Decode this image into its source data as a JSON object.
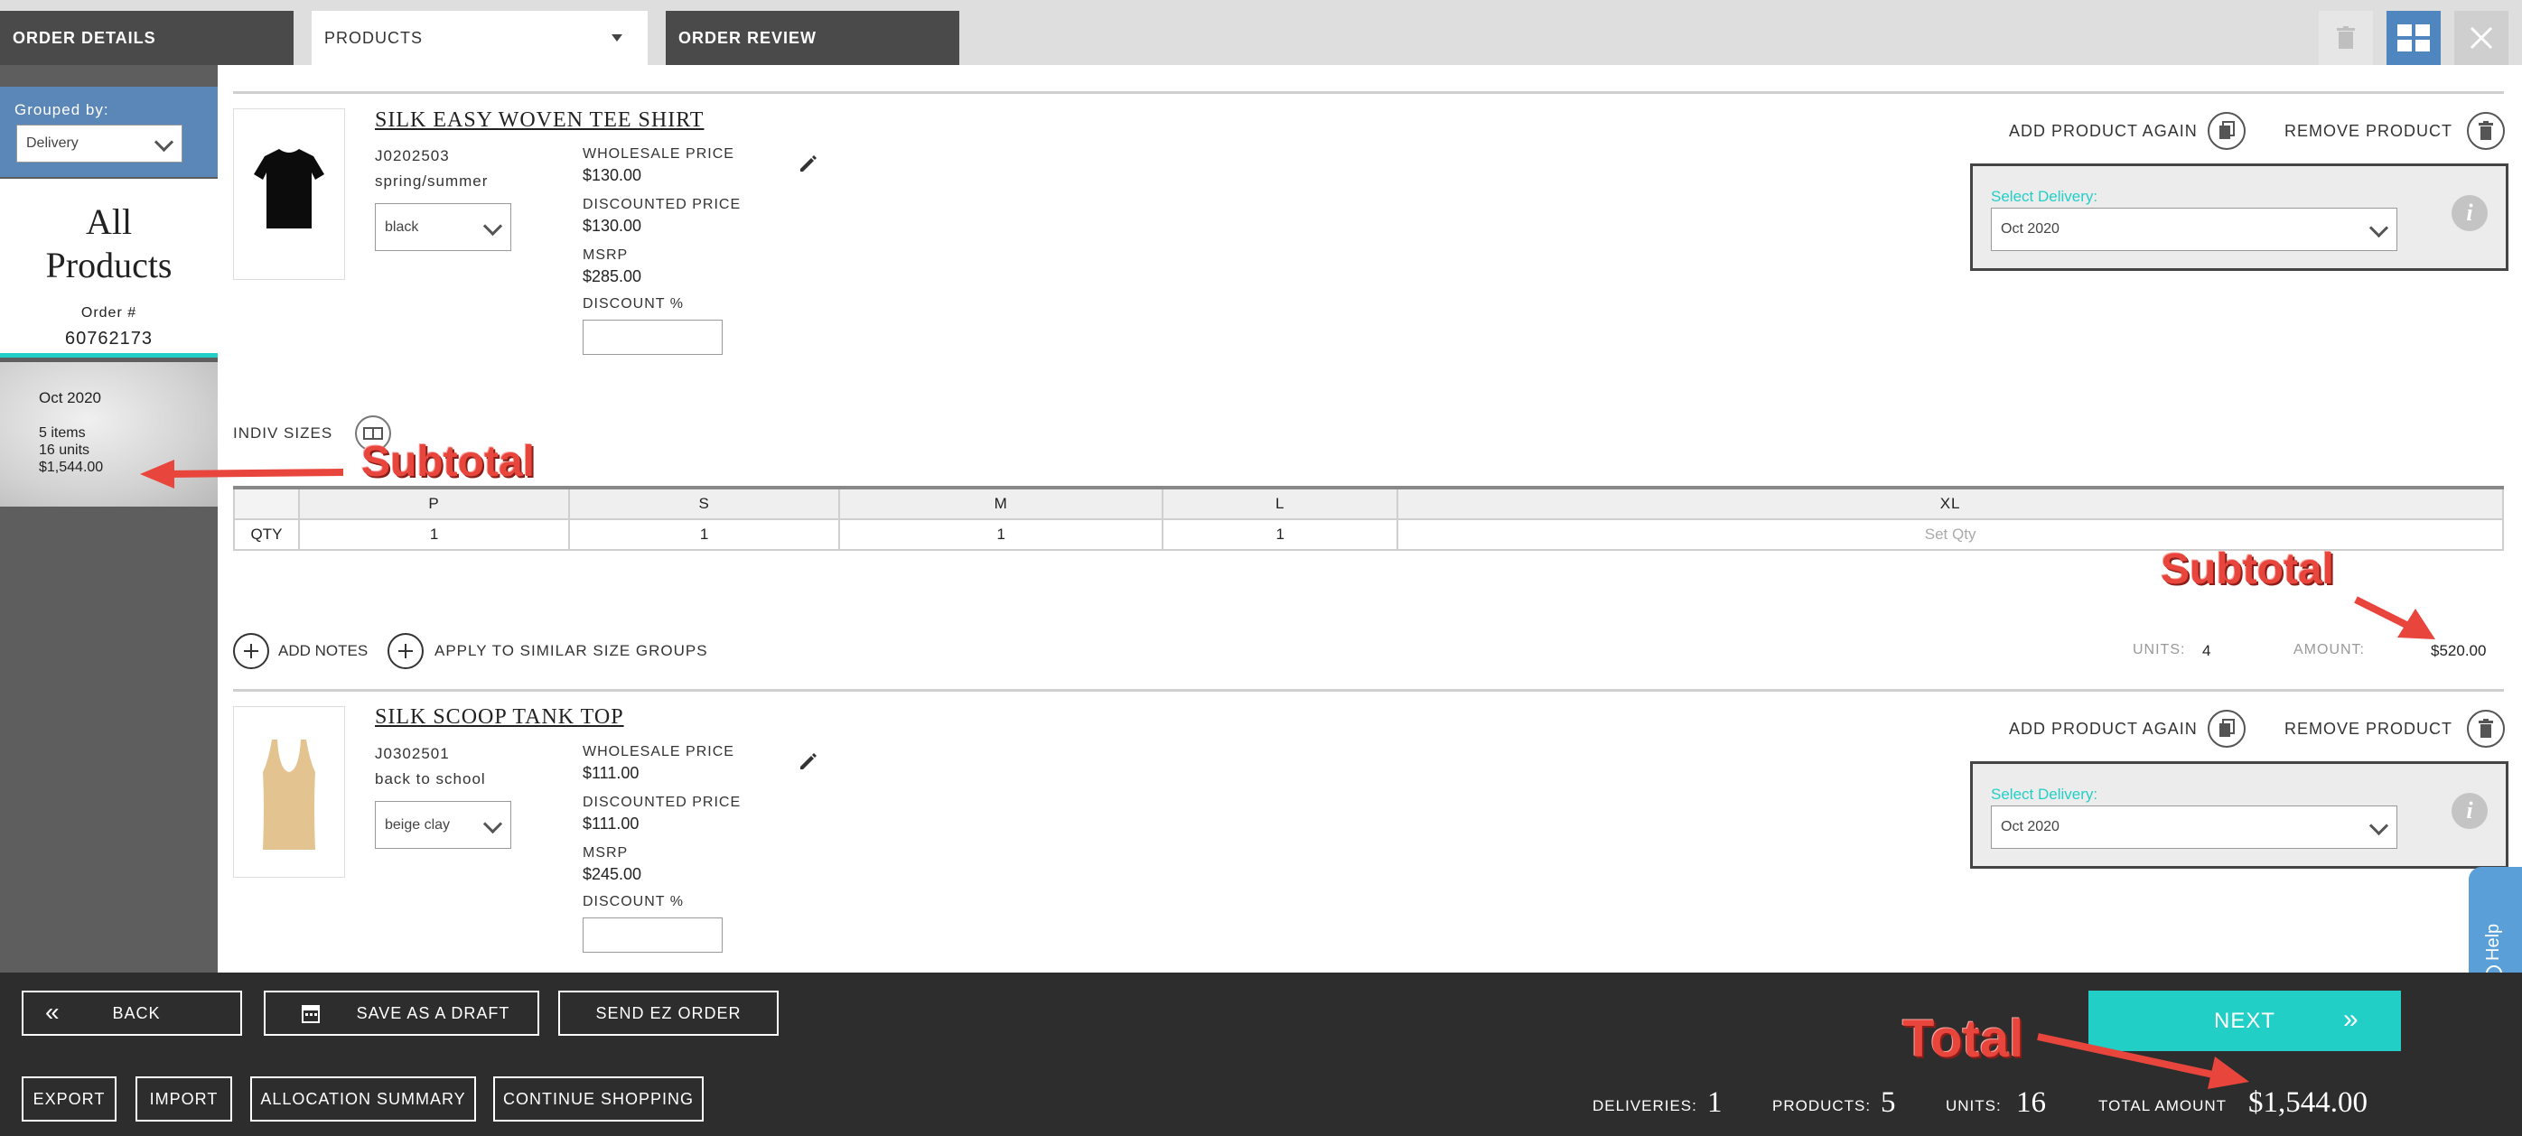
{
  "tabs": {
    "order_details": "ORDER DETAILS",
    "products": "PRODUCTS",
    "order_review": "ORDER REVIEW"
  },
  "sidebar": {
    "grouped_by_label": "Grouped by:",
    "grouped_by_value": "Delivery",
    "all_products_line1": "All",
    "all_products_line2": "Products",
    "order_label": "Order #",
    "order_number": "60762173",
    "group": {
      "delivery": "Oct 2020",
      "items": "5 items",
      "units": "16 units",
      "amount": "$1,544.00"
    }
  },
  "products": [
    {
      "title": "SILK EASY WOVEN TEE SHIRT",
      "sku": "J0202503",
      "season": "spring/summer",
      "color": "black",
      "wholesale_label": "WHOLESALE PRICE",
      "wholesale": "$130.00",
      "discounted_label": "DISCOUNTED PRICE",
      "discounted": "$130.00",
      "msrp_label": "MSRP",
      "msrp": "$285.00",
      "discount_label": "DISCOUNT %",
      "add_again": "ADD PRODUCT AGAIN",
      "remove": "REMOVE PRODUCT",
      "select_delivery_label": "Select Delivery:",
      "delivery": "Oct 2020"
    },
    {
      "title": "SILK SCOOP TANK TOP",
      "sku": "J0302501",
      "season": "back to school",
      "color": "beige clay",
      "wholesale_label": "WHOLESALE PRICE",
      "wholesale": "$111.00",
      "discounted_label": "DISCOUNTED PRICE",
      "discounted": "$111.00",
      "msrp_label": "MSRP",
      "msrp": "$245.00",
      "discount_label": "DISCOUNT %",
      "add_again": "ADD PRODUCT AGAIN",
      "remove": "REMOVE PRODUCT",
      "select_delivery_label": "Select Delivery:",
      "delivery": "Oct 2020"
    }
  ],
  "indiv_sizes": "INDIV SIZES",
  "size_table": {
    "row_label": "QTY",
    "sizes": [
      "P",
      "S",
      "M",
      "L",
      "XL"
    ],
    "qty": [
      "1",
      "1",
      "1",
      "1",
      "Set Qty"
    ]
  },
  "actions": {
    "add_notes": "ADD NOTES",
    "apply_similar": "APPLY TO SIMILAR SIZE GROUPS"
  },
  "product_subtotal": {
    "units_label": "UNITS:",
    "units": "4",
    "amount_label": "AMOUNT:",
    "amount": "$520.00"
  },
  "help": "Help",
  "bottom": {
    "back": "BACK",
    "save_draft": "SAVE AS A DRAFT",
    "send_ez": "SEND EZ ORDER",
    "export": "EXPORT",
    "import": "IMPORT",
    "allocation": "ALLOCATION SUMMARY",
    "continue": "CONTINUE SHOPPING",
    "next": "NEXT",
    "deliveries_label": "DELIVERIES:",
    "deliveries": "1",
    "products_label": "PRODUCTS:",
    "products": "5",
    "units_label": "UNITS:",
    "units": "16",
    "total_label": "TOTAL AMOUNT",
    "total": "$1,544.00"
  },
  "annotations": {
    "subtotal_left": "Subtotal",
    "subtotal_right": "Subtotal",
    "total": "Total"
  },
  "colors": {
    "accent_teal": "#22cfc6",
    "sidebar_blue": "#5b87b8",
    "annotation_red": "#e8453c",
    "bottom_bar": "#2d2d2d"
  }
}
